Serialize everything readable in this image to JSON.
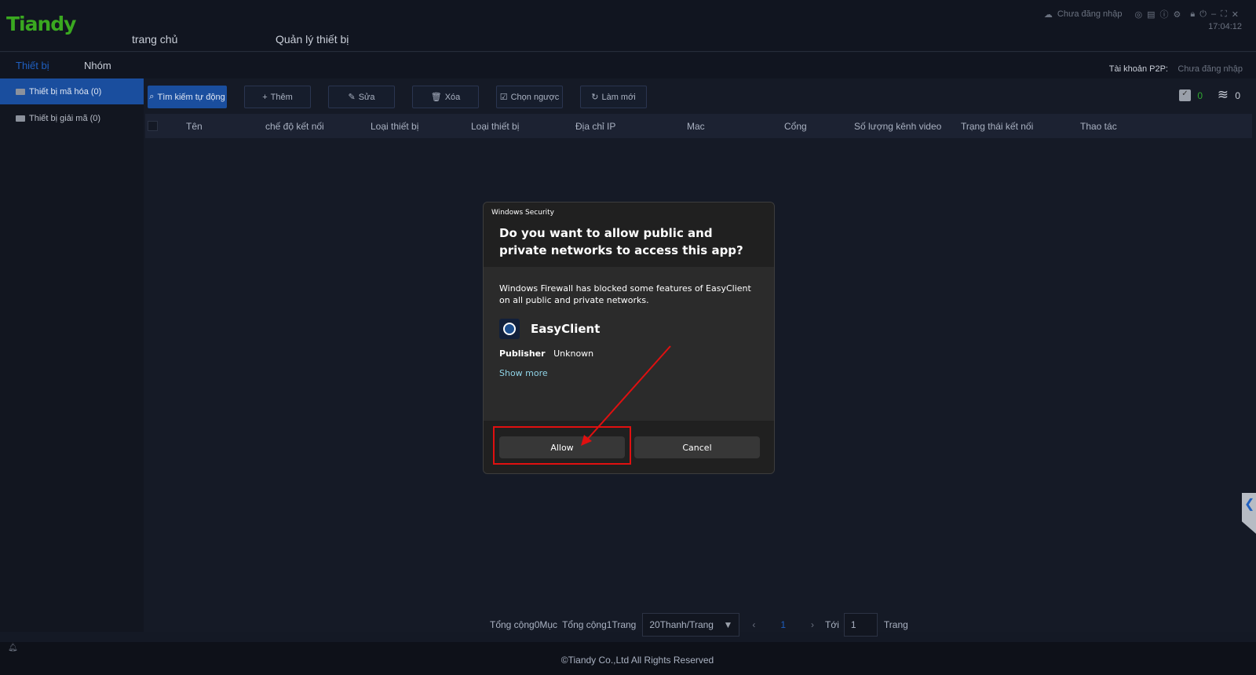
{
  "header": {
    "logo": "Tiandy",
    "nav": [
      "trang chủ",
      "Quản lý thiết bị"
    ],
    "login_status": "Chưa đăng nhập",
    "clock": "17:04:12"
  },
  "tabs": {
    "items": [
      "Thiết bị",
      "Nhóm"
    ],
    "active": 0,
    "p2p_label": "Tài khoản P2P:",
    "p2p_value": "Chưa đăng nhập"
  },
  "sidebar": {
    "items": [
      {
        "label": "Thiết bị mã hóa (0)",
        "selected": true
      },
      {
        "label": "Thiết bị giải mã (0)",
        "selected": false
      }
    ]
  },
  "toolbar": {
    "buttons": [
      "Tìm kiếm tự động",
      "Thêm",
      "Sửa",
      "Xóa",
      "Chọn ngược",
      "Làm mới"
    ],
    "online_count": "0",
    "total_count": "0"
  },
  "table": {
    "columns": [
      "Tên",
      "chế độ kết nối",
      "Loại thiết bị",
      "Loại thiết bị",
      "Địa chỉ IP",
      "Mac",
      "Cổng",
      "Số lượng kênh video",
      "Trạng thái kết nối",
      "Thao tác"
    ],
    "rows": []
  },
  "dialog": {
    "caption": "Windows Security",
    "title": "Do you want to allow public and private networks to access this app?",
    "message": "Windows Firewall has blocked some features of EasyClient on all public and private networks.",
    "app_name": "EasyClient",
    "publisher_label": "Publisher",
    "publisher_value": "Unknown",
    "show_more": "Show more",
    "allow": "Allow",
    "cancel": "Cancel",
    "highlight_color": "#e01010"
  },
  "pagination": {
    "total_items": "Tổng cộng0Mục",
    "total_pages": "Tổng cộng1Trang",
    "page_size": "20Thanh/Trang",
    "current_page": "1",
    "goto_label": "Tới",
    "goto_value": "1",
    "page_suffix": "Trang"
  },
  "footer": {
    "copyright": "©Tiandy Co.,Ltd All Rights Reserved"
  }
}
